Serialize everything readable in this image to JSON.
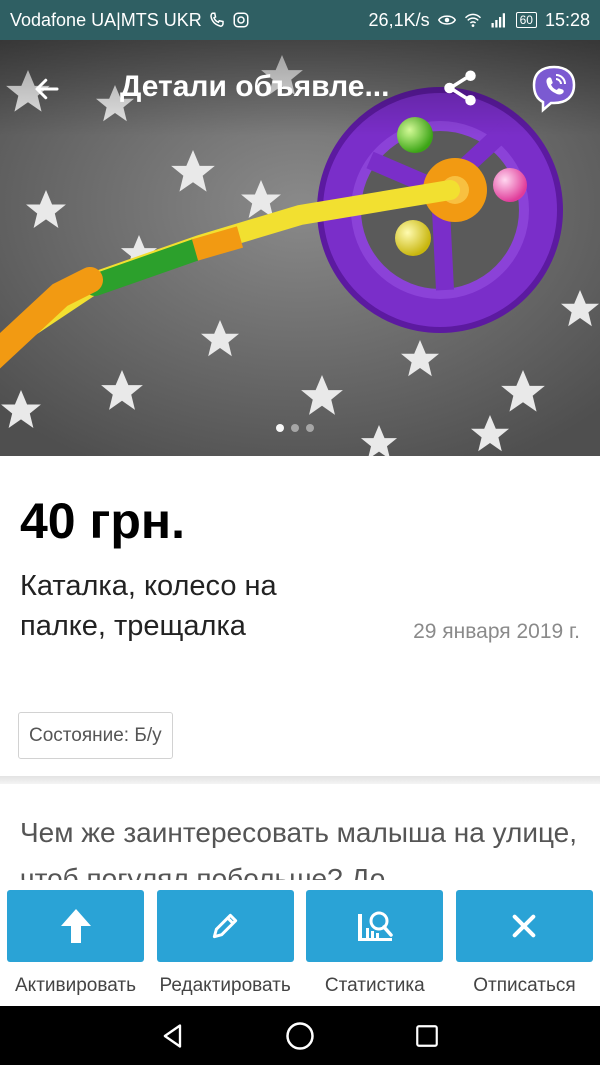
{
  "status_bar": {
    "carrier": "Vodafone UA|MTS UKR",
    "net_speed": "26,1K/s",
    "battery": "60",
    "time": "15:28"
  },
  "toolbar": {
    "title": "Детали объявле...",
    "back_icon": "arrow-left-icon",
    "share_icon": "share-icon",
    "viber_icon": "viber-icon"
  },
  "gallery": {
    "pages": 3,
    "active_page": 1
  },
  "listing": {
    "price": "40 грн.",
    "title": "Каталка, колесо на палке, трещалка",
    "date": "29 января 2019 г.",
    "condition": "Состояние: Б/у",
    "description": "Чем же заинтересовать малыша на улице, чтоб погулял побольше? До"
  },
  "actions": [
    {
      "label": "Активировать",
      "icon": "arrow-up-icon"
    },
    {
      "label": "Редактировать",
      "icon": "pencil-icon"
    },
    {
      "label": "Статистика",
      "icon": "statistics-icon"
    },
    {
      "label": "Отписаться",
      "icon": "close-icon"
    }
  ],
  "colors": {
    "status_bar": "#2f5f63",
    "accent": "#2aa3d6",
    "viber": "#7b5ad1"
  }
}
